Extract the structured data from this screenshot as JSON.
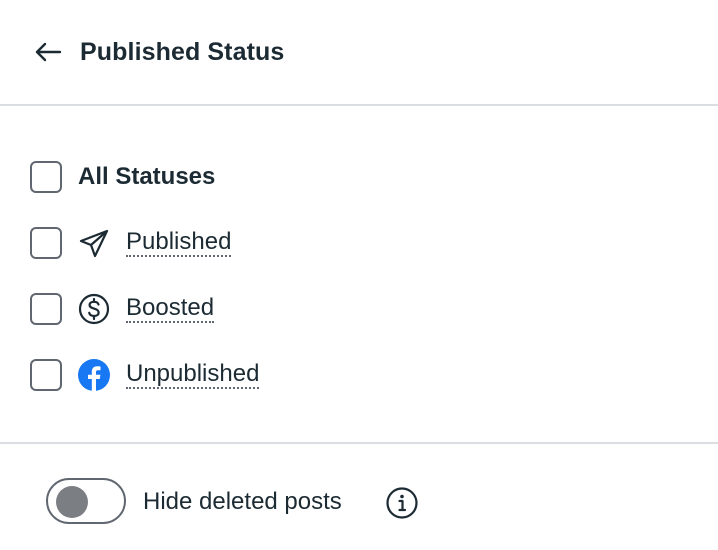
{
  "header": {
    "title": "Published Status",
    "back_icon": "arrow-left-icon"
  },
  "options": [
    {
      "label": "All Statuses",
      "checked": false,
      "icon": ""
    },
    {
      "label": "Published",
      "checked": false,
      "icon": "paper-plane-icon"
    },
    {
      "label": "Boosted",
      "checked": false,
      "icon": "dollar-circle-icon"
    },
    {
      "label": "Unpublished",
      "checked": false,
      "icon": "facebook-icon"
    }
  ],
  "footer": {
    "toggle_label": "Hide deleted posts",
    "toggle_on": false,
    "info_icon": "info-icon"
  },
  "colors": {
    "text": "#1c2b33",
    "border": "#606770",
    "divider": "#dadde1",
    "facebook_blue": "#1877f2",
    "toggle_knob": "#7b7f83"
  }
}
